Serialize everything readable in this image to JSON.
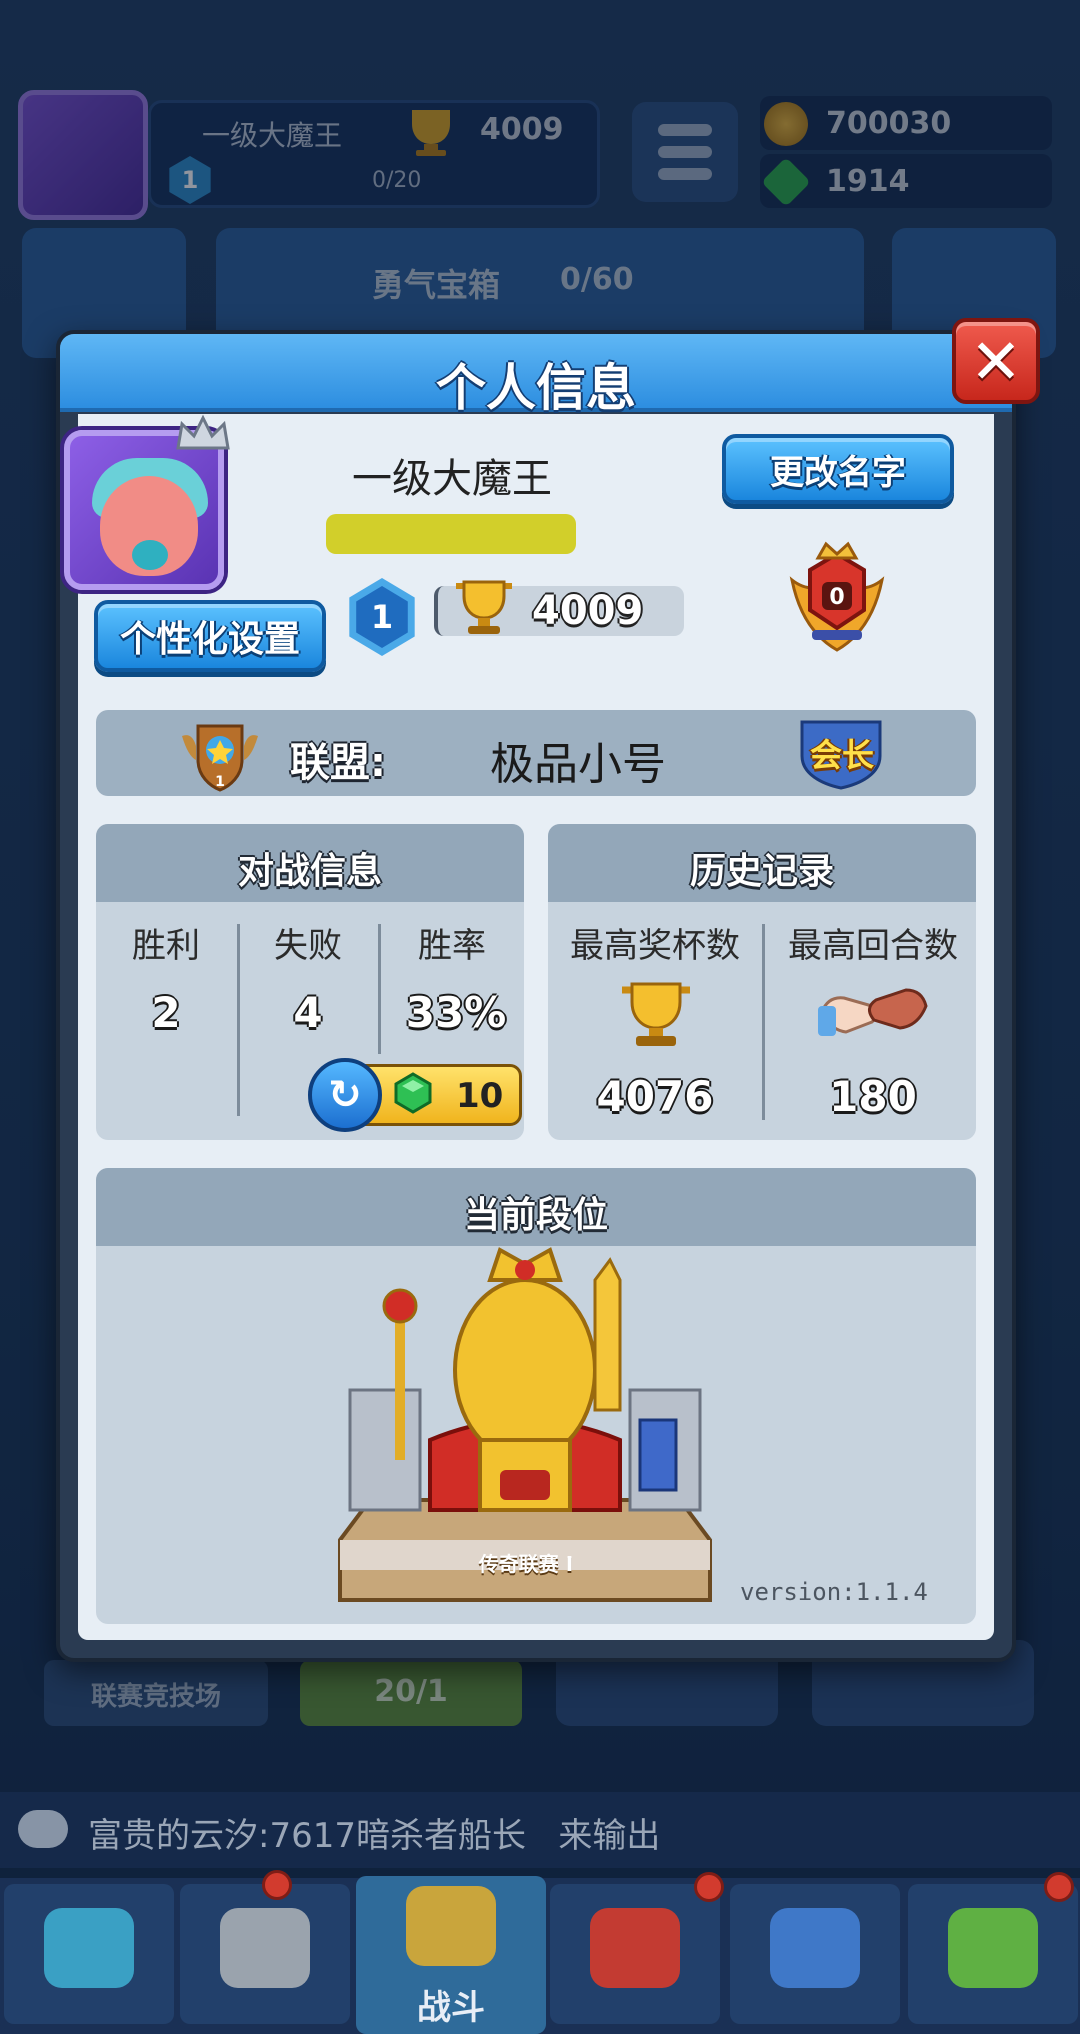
{
  "hud": {
    "player_name": "一级大魔王",
    "trophies": "4009",
    "level": "1",
    "xp": "0/20",
    "gold": "700030",
    "gems": "1914",
    "chest_label": "勇气宝箱",
    "chest_count": "0/60"
  },
  "modal": {
    "title": "个人信息",
    "close_glyph": "✕",
    "player_name": "一级大魔王",
    "rename_label": "更改名字",
    "customize_label": "个性化设置",
    "level": "1",
    "trophies": "4009",
    "rank_badge_value": "0",
    "alliance": {
      "label": "联盟:",
      "name": "极品小号",
      "role": "会长",
      "badge_level": "1"
    },
    "battle": {
      "title": "对战信息",
      "headers": [
        "胜利",
        "失败",
        "胜率"
      ],
      "values": [
        "2",
        "4",
        "33%"
      ],
      "reset_cost": "10"
    },
    "history": {
      "title": "历史记录",
      "headers": [
        "最高奖杯数",
        "最高回合数"
      ],
      "values": [
        "4076",
        "180"
      ]
    },
    "rank": {
      "title": "当前段位",
      "league_name": "传奇联赛 I",
      "version": "version:1.1.4"
    }
  },
  "background": {
    "league_button": "联赛竞技场",
    "key_count": "20/1"
  },
  "chat": {
    "text": "富贵的云汐:7617暗杀者船长   来输出"
  },
  "nav": {
    "battle_label": "战斗"
  },
  "colors": {
    "header_blue": "#2d8ee0",
    "close_red": "#c7271c",
    "panel_head": "#93a7b9",
    "gold": "#f0b41d",
    "gem_green": "#28b548"
  }
}
